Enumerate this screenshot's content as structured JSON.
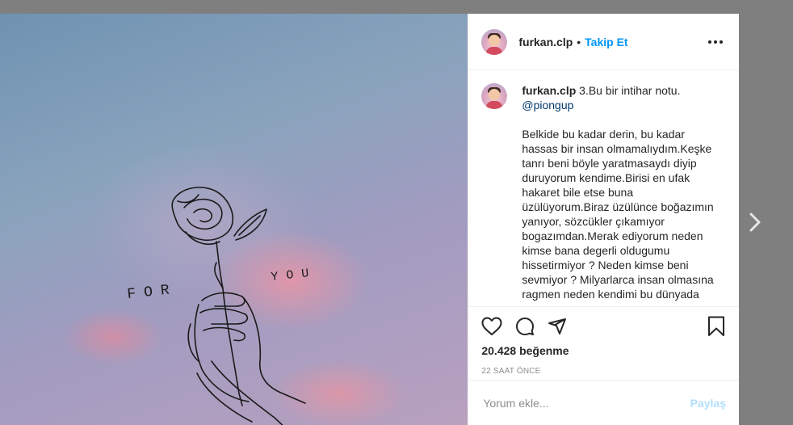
{
  "post": {
    "username": "furkan.clp",
    "separator": "•",
    "follow_label": "Takip Et",
    "more_icon": "more-horizontal-icon"
  },
  "caption": {
    "username": "furkan.clp",
    "title": "3.Bu bir intihar notu.",
    "mention": "@piongup",
    "body": "Belkide bu kadar derin, bu kadar hassas bir insan olmamalıydım.Keşke tanrı beni böyle yaratmasaydı diyip duruyorum kendime.Birisi en ufak hakaret bile etse buna üzülüyorum.Biraz üzülünce boğazımın yanıyor, sözcükler çıkamıyor bogazımdan.Merak ediyorum neden kimse bana degerli oldugumu hissetirmiyor ? Neden kimse beni sevmiyor ? Milyarlarca insan olmasına ragmen neden kendimi bu dünyada"
  },
  "image": {
    "text_left": "FOR",
    "text_right": "YOU"
  },
  "actions": {
    "like_icon": "heart-icon",
    "comment_icon": "comment-icon",
    "share_icon": "share-icon",
    "save_icon": "bookmark-icon"
  },
  "likes": "20.428 beğenme",
  "timestamp": "22 SAAT ÖNCE",
  "comment_input": {
    "placeholder": "Yorum ekle...",
    "post_label": "Paylaş"
  },
  "navigation": {
    "next_icon": "chevron-right-icon"
  },
  "colors": {
    "accent": "#0095f6",
    "post_disabled": "#b2dffc",
    "text": "#262626",
    "muted": "#8e8e8e"
  }
}
